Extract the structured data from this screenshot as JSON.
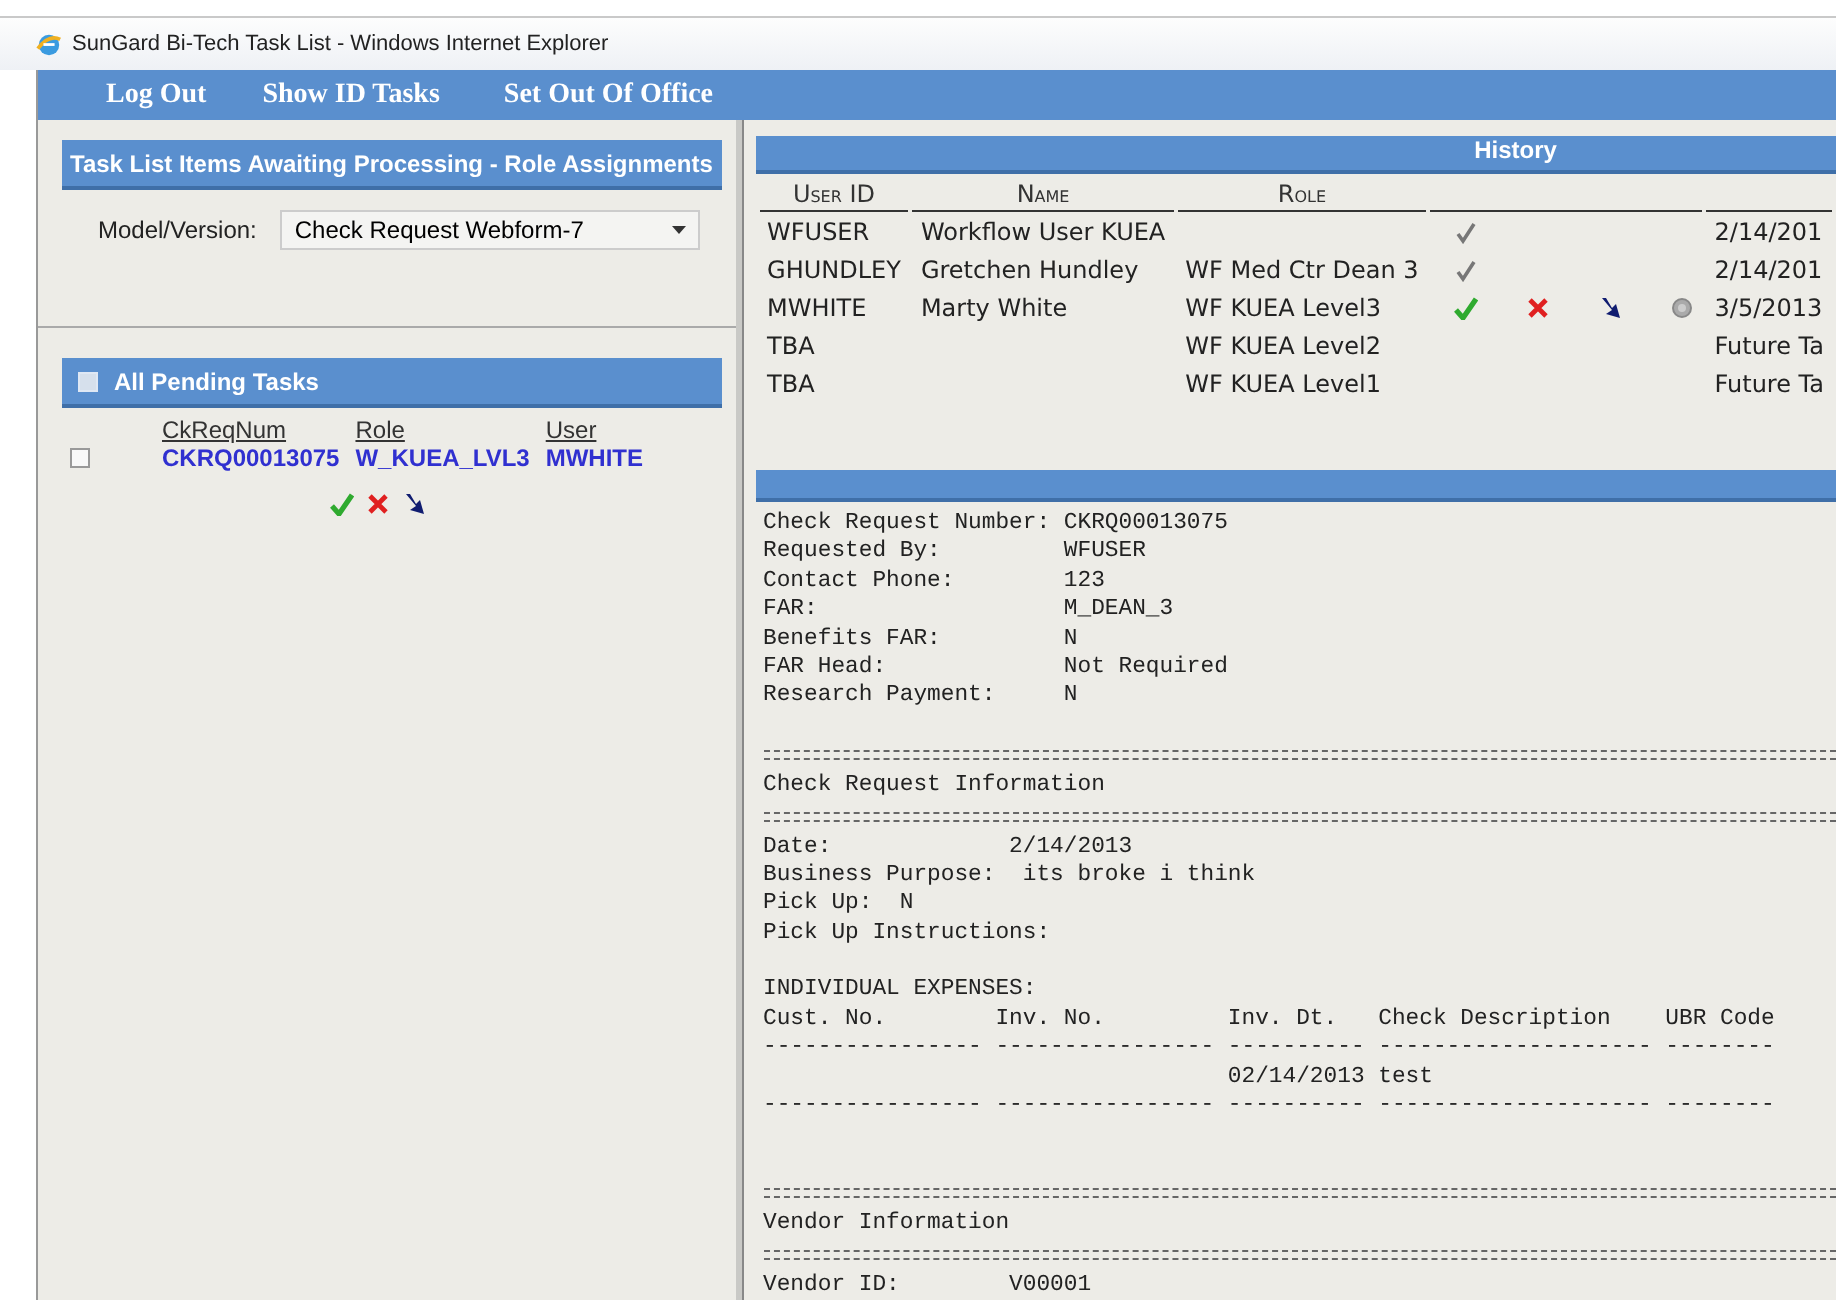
{
  "window": {
    "title": "SunGard Bi-Tech Task List - Windows Internet Explorer"
  },
  "nav": [
    "Log Out",
    "Show ID Tasks",
    "Set Out Of Office"
  ],
  "role_panel": {
    "title": "Task List Items Awaiting Processing - Role Assignments",
    "model_label": "Model/Version:",
    "model_value": "Check Request Webform-7"
  },
  "pending": {
    "title": "All Pending Tasks",
    "all_checked": false,
    "columns": [
      "CkReqNum",
      "Role",
      "User"
    ],
    "rows": [
      {
        "checked": false,
        "cells": [
          "CKRQ00013075",
          "W_KUEA_LVL3",
          "MWHITE"
        ]
      }
    ],
    "actions": [
      {
        "kind": "approve"
      },
      {
        "kind": "reject"
      },
      {
        "kind": "forward"
      }
    ]
  },
  "history": {
    "title": "History",
    "columns": [
      "User ID",
      "Name",
      "Role"
    ],
    "rows": [
      {
        "user_id": "WFUSER",
        "name": "Workflow User KUEA",
        "role": "",
        "actions": [
          {
            "kind": "done"
          }
        ],
        "date": "2/14/201"
      },
      {
        "user_id": "GHUNDLEY",
        "name": "Gretchen Hundley",
        "role": "WF Med Ctr Dean 3",
        "actions": [
          {
            "kind": "done"
          }
        ],
        "date": "2/14/201"
      },
      {
        "user_id": "MWHITE",
        "name": "Marty White",
        "role": "WF KUEA Level3",
        "actions": [
          {
            "kind": "approve"
          },
          {
            "kind": "reject"
          },
          {
            "kind": "forward"
          },
          {
            "kind": "hold"
          }
        ],
        "date": "3/5/2013"
      },
      {
        "user_id": "TBA",
        "name": "",
        "role": "WF KUEA Level2",
        "actions": [],
        "date": "Future Ta"
      },
      {
        "user_id": "TBA",
        "name": "",
        "role": "WF KUEA Level1",
        "actions": [],
        "date": "Future Ta"
      }
    ]
  },
  "document": {
    "lines": [
      {
        "kind": "text",
        "text": "Check Request Number: CKRQ00013075"
      },
      {
        "kind": "text",
        "text": "Requested By:         WFUSER"
      },
      {
        "kind": "text",
        "text": "Contact Phone:        123"
      },
      {
        "kind": "text",
        "text": "FAR:                  M_DEAN_3"
      },
      {
        "kind": "text",
        "text": "Benefits FAR:         N"
      },
      {
        "kind": "text",
        "text": "FAR Head:             Not Required"
      },
      {
        "kind": "text",
        "text": "Research Payment:     N"
      },
      {
        "kind": "blank"
      },
      {
        "kind": "rule"
      },
      {
        "kind": "text",
        "text": "Check Request Information"
      },
      {
        "kind": "rule"
      },
      {
        "kind": "text",
        "text": "Date:             2/14/2013"
      },
      {
        "kind": "text",
        "text": "Business Purpose:  its broke i think"
      },
      {
        "kind": "text",
        "text": "Pick Up:  N"
      },
      {
        "kind": "text",
        "text": "Pick Up Instructions:"
      },
      {
        "kind": "blank"
      },
      {
        "kind": "text",
        "text": "INDIVIDUAL EXPENSES:"
      },
      {
        "kind": "text",
        "text": "Cust. No.        Inv. No.         Inv. Dt.   Check Description    UBR Code"
      },
      {
        "kind": "text",
        "text": "---------------- ---------------- ---------- -------------------- --------"
      },
      {
        "kind": "text",
        "text": "                                  02/14/2013 test"
      },
      {
        "kind": "text",
        "text": "---------------- ---------------- ---------- -------------------- --------"
      },
      {
        "kind": "blank"
      },
      {
        "kind": "blank"
      },
      {
        "kind": "rule"
      },
      {
        "kind": "text",
        "text": "Vendor Information"
      },
      {
        "kind": "rule"
      },
      {
        "kind": "text",
        "text": "Vendor ID:        V00001"
      }
    ]
  }
}
